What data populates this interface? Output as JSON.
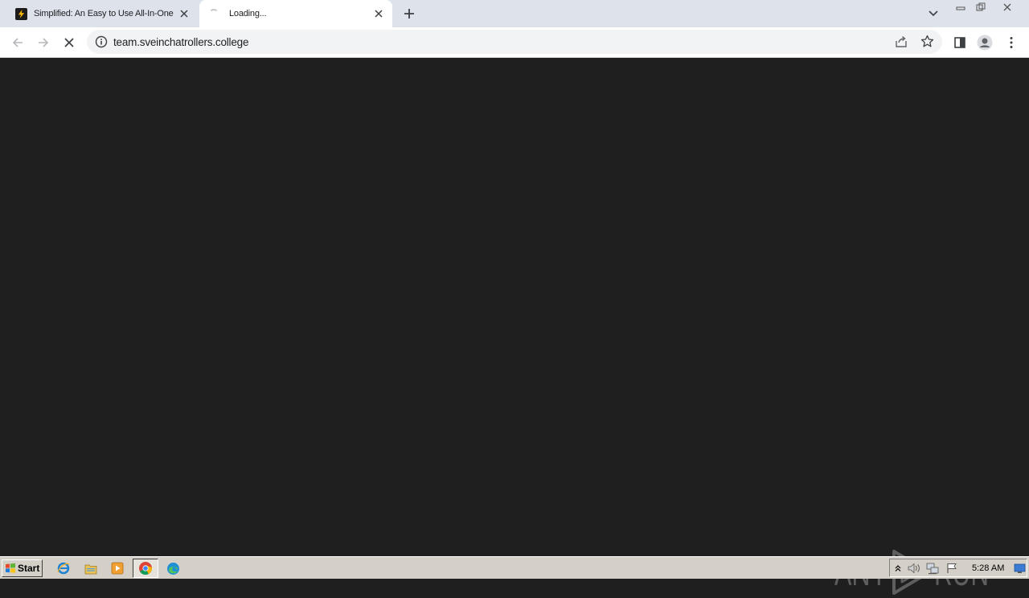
{
  "browser": {
    "tabs": [
      {
        "title": "Simplified: An Easy to Use All-In-One",
        "state": "inactive",
        "favicon": "lightning-bolt-icon"
      },
      {
        "title": "Loading...",
        "state": "active",
        "favicon": "loading-spinner-icon"
      }
    ],
    "address_bar": {
      "url": "team.sveinchatrollers.college"
    }
  },
  "watermark": {
    "text": "ANY RUN"
  },
  "taskbar": {
    "start_label": "Start",
    "clock": "5:28 AM"
  },
  "colors": {
    "content_bg": "#1f1f1f",
    "tabstrip_bg": "#dee3eb",
    "omnibox_bg": "#f1f3f4",
    "taskbar_bg": "#d4d0c8"
  }
}
